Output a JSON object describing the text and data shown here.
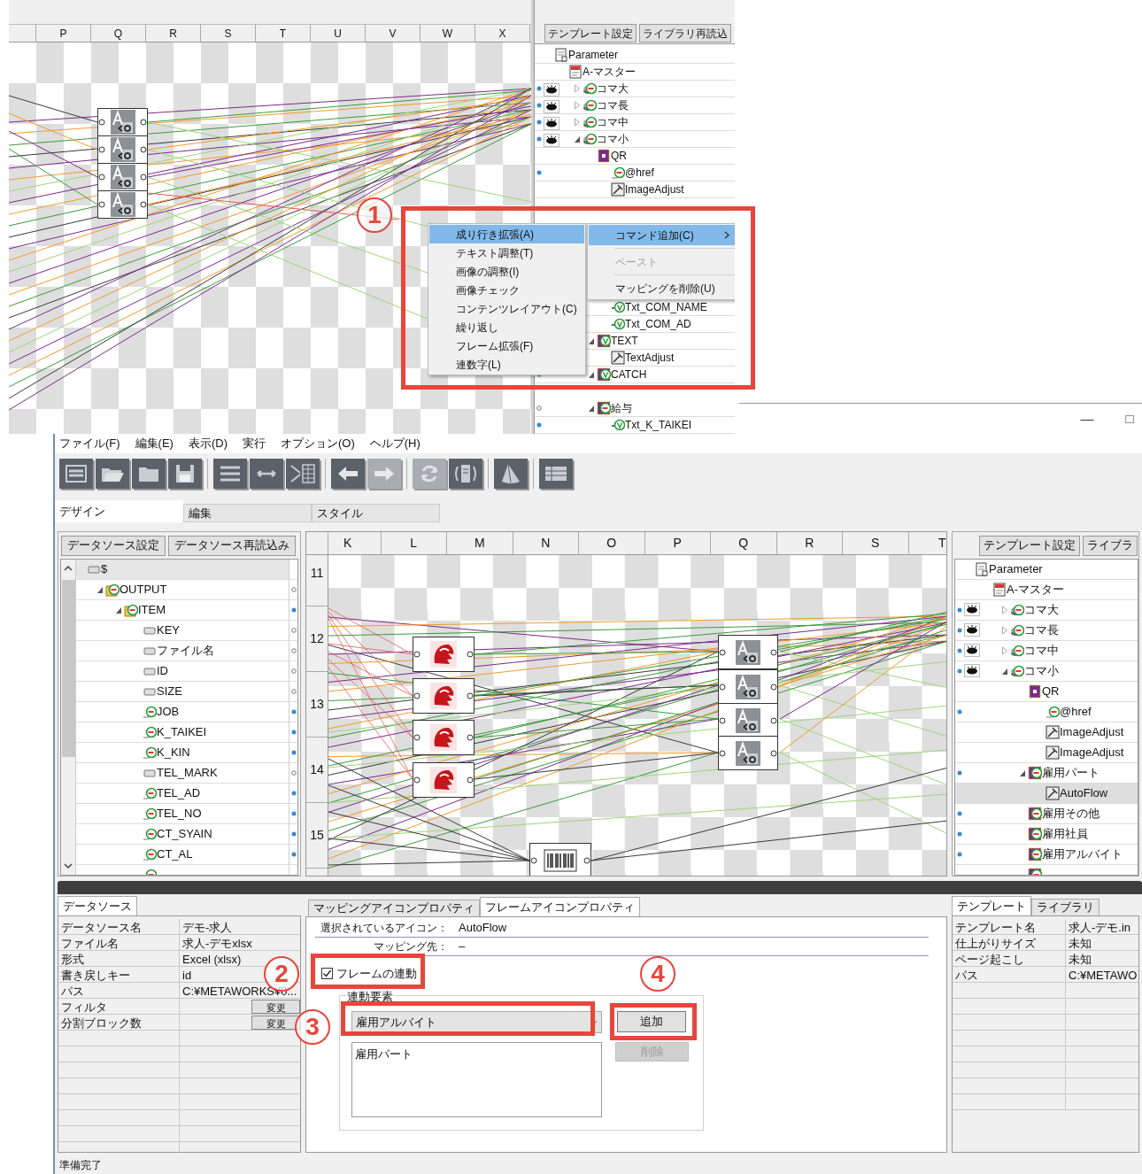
{
  "inset": {
    "canvas_columns": [
      "P",
      "Q",
      "R",
      "S",
      "T",
      "U",
      "V",
      "W",
      "X"
    ],
    "panel_buttons": [
      "テンプレート設定",
      "ライブラリ再読込"
    ],
    "tree": [
      {
        "label": "Parameter",
        "kind": "doc",
        "selected": false,
        "children": [
          {
            "label": "A-マスター",
            "kind": "html",
            "selected": false,
            "children": [
              {
                "label": "コマ大",
                "kind": "stack",
                "mapped": true,
                "visible": true,
                "expanded": false,
                "selected": false
              },
              {
                "label": "コマ長",
                "kind": "stack",
                "mapped": true,
                "visible": true,
                "expanded": false,
                "selected": false
              },
              {
                "label": "コマ中",
                "kind": "stack",
                "mapped": true,
                "visible": true,
                "expanded": false,
                "selected": false
              },
              {
                "label": "コマ小",
                "kind": "stack",
                "mapped": true,
                "visible": true,
                "expanded": true,
                "selected": false,
                "children": [
                  {
                    "label": "QR",
                    "kind": "qr",
                    "selected": false,
                    "children": [
                      {
                        "label": "@href",
                        "kind": "field",
                        "mapped": true,
                        "selected": false
                      },
                      {
                        "label": "ImageAdjust",
                        "kind": "adjust",
                        "selected": false
                      }
                    ]
                  }
                ]
              }
            ]
          }
        ]
      }
    ],
    "tree_lower": [
      {
        "kind": "frame",
        "selected": false,
        "children": [
          {
            "label": "Txt_COM_NAME",
            "kind": "check",
            "selected": false
          },
          {
            "label": "Txt_COM_AD",
            "kind": "check",
            "selected": false
          }
        ]
      },
      {
        "label": "TEXT",
        "kind": "framecheck",
        "expanded": true,
        "selected": false,
        "children": [
          {
            "label": "TextAdjust",
            "kind": "adjust",
            "selected": false
          }
        ]
      },
      {
        "label": "CATCH",
        "kind": "framecheck",
        "mapped": true,
        "expanded": true,
        "selected": false
      }
    ],
    "tree_bottom": [
      {
        "label": "給与",
        "kind": "frame",
        "mapped": false,
        "expanded": true,
        "selected": false,
        "children": [
          {
            "label": "Txt_K_TAIKEI",
            "kind": "check",
            "mapped": true,
            "selected": false
          }
        ]
      }
    ],
    "context_menu": {
      "items": [
        {
          "label": "成り行き拡張(A)",
          "selected": true
        },
        {
          "label": "テキスト調整(T)",
          "selected": false
        },
        {
          "label": "画像の調整(I)",
          "selected": false
        },
        {
          "label": "画像チェック",
          "selected": false
        },
        {
          "label": "コンテンツレイアウト(C)",
          "selected": false
        },
        {
          "label": "繰り返し",
          "selected": false
        },
        {
          "label": "フレーム拡張(F)",
          "selected": false
        },
        {
          "label": "連数字(L)",
          "selected": false
        }
      ],
      "submenu": [
        {
          "label": "コマンド追加(C)",
          "selected": true,
          "disabled": false,
          "has_submenu": true
        },
        {
          "label": "ペースト",
          "selected": false,
          "disabled": true,
          "has_submenu": false
        },
        {
          "label": "マッピングを削除(U)",
          "selected": false,
          "disabled": false,
          "has_submenu": false
        }
      ]
    }
  },
  "window_controls": [
    "—",
    "□"
  ],
  "menu": [
    "ファイル(F)",
    "編集(E)",
    "表示(D)",
    "実行",
    "オプション(O)",
    "ヘルプ(H)"
  ],
  "toolbar": [
    {
      "kind": "text",
      "disabled": false
    },
    {
      "kind": "open",
      "disabled": false
    },
    {
      "kind": "folder",
      "disabled": false
    },
    {
      "kind": "save",
      "disabled": false
    },
    {
      "kind": "separator"
    },
    {
      "kind": "rows",
      "disabled": false
    },
    {
      "kind": "link",
      "disabled": false
    },
    {
      "kind": "grid",
      "disabled": false
    },
    {
      "kind": "separator"
    },
    {
      "kind": "back",
      "disabled": false
    },
    {
      "kind": "forward",
      "disabled": true
    },
    {
      "kind": "separator"
    },
    {
      "kind": "refresh",
      "disabled": true
    },
    {
      "kind": "server",
      "disabled": false
    },
    {
      "kind": "separator"
    },
    {
      "kind": "cone",
      "disabled": false
    },
    {
      "kind": "separator"
    },
    {
      "kind": "table",
      "disabled": false
    }
  ],
  "tabs": [
    {
      "label": "デザイン",
      "selected": true
    },
    {
      "label": "編集",
      "selected": false
    },
    {
      "label": "スタイル",
      "selected": false
    }
  ],
  "datasource_panel": {
    "buttons": [
      "データソース設定",
      "データソース再読込み"
    ],
    "tree": [
      {
        "label": "$",
        "kind": "box",
        "selected": false,
        "children": [
          {
            "label": "OUTPUT",
            "kind": "folderfield",
            "expanded": true,
            "mapped": false,
            "selected": false,
            "children": [
              {
                "label": "ITEM",
                "kind": "folderfield",
                "expanded": true,
                "mapped": true,
                "selected": false,
                "children": [
                  {
                    "label": "KEY",
                    "kind": "box",
                    "mapped": false,
                    "selected": false
                  },
                  {
                    "label": "ファイル名",
                    "kind": "box",
                    "mapped": false,
                    "selected": false
                  },
                  {
                    "label": "ID",
                    "kind": "box",
                    "mapped": false,
                    "selected": false
                  },
                  {
                    "label": "SIZE",
                    "kind": "box",
                    "mapped": false,
                    "selected": false
                  },
                  {
                    "label": "JOB",
                    "kind": "field",
                    "mapped": true,
                    "selected": false
                  },
                  {
                    "label": "K_TAIKEI",
                    "kind": "field",
                    "mapped": true,
                    "selected": false
                  },
                  {
                    "label": "K_KIN",
                    "kind": "field",
                    "mapped": true,
                    "selected": false
                  },
                  {
                    "label": "TEL_MARK",
                    "kind": "box",
                    "mapped": false,
                    "selected": false
                  },
                  {
                    "label": "TEL_AD",
                    "kind": "field",
                    "mapped": true,
                    "selected": false
                  },
                  {
                    "label": "TEL_NO",
                    "kind": "field",
                    "mapped": true,
                    "selected": false
                  },
                  {
                    "label": "CT_SYAIN",
                    "kind": "field",
                    "mapped": true,
                    "selected": false
                  },
                  {
                    "label": "CT_AL",
                    "kind": "field",
                    "mapped": true,
                    "selected": false
                  },
                  {
                    "kind": "field",
                    "selected": false
                  }
                ]
              }
            ]
          }
        ]
      }
    ]
  },
  "canvas": {
    "columns": [
      "K",
      "L",
      "M",
      "N",
      "O",
      "P",
      "Q",
      "R",
      "S",
      "T"
    ],
    "rows": [
      "11",
      "12",
      "13",
      "14",
      "15"
    ]
  },
  "template_panel": {
    "buttons": [
      "テンプレート設定",
      "ライブラ"
    ],
    "tree": [
      {
        "label": "Parameter",
        "kind": "doc",
        "selected": false,
        "children": [
          {
            "label": "A-マスター",
            "kind": "html",
            "selected": false,
            "children": [
              {
                "label": "コマ大",
                "kind": "stack",
                "mapped": true,
                "visible": true,
                "expanded": false,
                "selected": false
              },
              {
                "label": "コマ長",
                "kind": "stack",
                "mapped": true,
                "visible": true,
                "expanded": false,
                "selected": false
              },
              {
                "label": "コマ中",
                "kind": "stack",
                "mapped": true,
                "visible": true,
                "expanded": false,
                "selected": false
              },
              {
                "label": "コマ小",
                "kind": "stack",
                "mapped": true,
                "visible": true,
                "expanded": true,
                "selected": false,
                "children": [
                  {
                    "label": "QR",
                    "kind": "qr",
                    "selected": false,
                    "children": [
                      {
                        "label": "@href",
                        "kind": "field",
                        "mapped": true,
                        "selected": false
                      },
                      {
                        "label": "ImageAdjust",
                        "kind": "adjust",
                        "selected": false
                      },
                      {
                        "label": "ImageAdjust",
                        "kind": "adjust",
                        "selected": false
                      }
                    ]
                  },
                  {
                    "label": "雇用パート",
                    "kind": "frame",
                    "mapped": true,
                    "expanded": true,
                    "selected": false,
                    "children": [
                      {
                        "label": "AutoFlow",
                        "kind": "adjust",
                        "selected": true
                      }
                    ]
                  },
                  {
                    "label": "雇用その他",
                    "kind": "frame",
                    "mapped": true,
                    "selected": false
                  },
                  {
                    "label": "雇用社員",
                    "kind": "frame",
                    "mapped": true,
                    "selected": false
                  },
                  {
                    "label": "雇用アルバイト",
                    "kind": "frame",
                    "mapped": true,
                    "selected": false
                  },
                  {
                    "kind": "frame",
                    "selected": false
                  }
                ]
              }
            ]
          }
        ]
      }
    ]
  },
  "datasource_props": {
    "tabs": [
      {
        "label": "データソース",
        "selected": true
      }
    ],
    "rows": [
      {
        "label": "データソース名",
        "value": "デモ-求人"
      },
      {
        "label": "ファイル名",
        "value": "求人-デモxlsx"
      },
      {
        "label": "形式",
        "value": "Excel (xlsx)"
      },
      {
        "label": "書き戻しキー",
        "value": "id"
      },
      {
        "label": "パス",
        "value": "C:¥METAWORKS¥0..."
      },
      {
        "label": "フィルタ",
        "button": "変更"
      },
      {
        "label": "分割ブロック数",
        "button": "変更"
      }
    ]
  },
  "frame_props": {
    "tabs": [
      {
        "label": "マッピングアイコンプロパティ",
        "selected": false
      },
      {
        "label": "フレームアイコンプロパティ",
        "selected": true
      }
    ],
    "fields": [
      {
        "label": "選択されているアイコン：",
        "value": "AutoFlow"
      },
      {
        "label": "マッピング先：",
        "value": "–"
      }
    ],
    "link_checkbox": {
      "label": "フレームの連動",
      "checked": true
    },
    "group": {
      "legend": "連動要素",
      "dropdown": {
        "value": "雇用アルバイト"
      },
      "add_button": {
        "label": "追加",
        "disabled": false
      },
      "list": [
        {
          "label": "雇用パート",
          "selected": false
        }
      ],
      "remove_button": {
        "label": "削除",
        "disabled": true
      }
    }
  },
  "template_props": {
    "tabs": [
      {
        "label": "テンプレート",
        "selected": true
      },
      {
        "label": "ライブラリ",
        "selected": false
      }
    ],
    "rows": [
      {
        "label": "テンプレート名",
        "value": "求人-デモ.in"
      },
      {
        "label": "仕上がりサイズ",
        "value": "未知"
      },
      {
        "label": "ページ起こし",
        "value": "未知"
      },
      {
        "label": "パス",
        "value": "C:¥METAWO"
      }
    ]
  },
  "status_bar": "準備完了",
  "annotations": [
    {
      "label": "1"
    },
    {
      "label": "2"
    },
    {
      "label": "3"
    },
    {
      "label": "4"
    }
  ]
}
